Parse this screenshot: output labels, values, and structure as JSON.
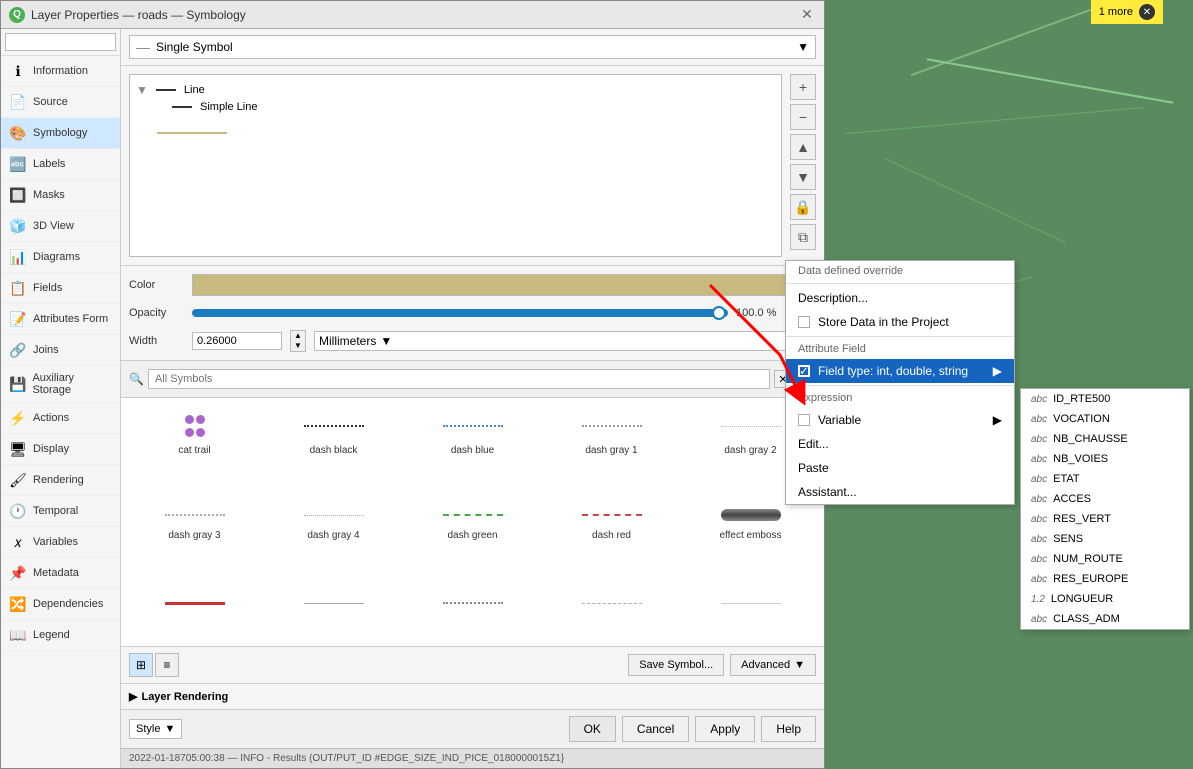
{
  "window": {
    "title": "Layer Properties — roads — Symbology",
    "close_label": "✕"
  },
  "sidebar": {
    "search_placeholder": "",
    "items": [
      {
        "id": "information",
        "label": "Information",
        "icon": "ℹ"
      },
      {
        "id": "source",
        "label": "Source",
        "icon": "📄"
      },
      {
        "id": "symbology",
        "label": "Symbology",
        "icon": "🎨",
        "active": true
      },
      {
        "id": "labels",
        "label": "Labels",
        "icon": "🔤"
      },
      {
        "id": "masks",
        "label": "Masks",
        "icon": "🔲"
      },
      {
        "id": "3d-view",
        "label": "3D View",
        "icon": "🧊"
      },
      {
        "id": "diagrams",
        "label": "Diagrams",
        "icon": "📊"
      },
      {
        "id": "fields",
        "label": "Fields",
        "icon": "📋"
      },
      {
        "id": "attributes-form",
        "label": "Attributes Form",
        "icon": "📝"
      },
      {
        "id": "joins",
        "label": "Joins",
        "icon": "🔗"
      },
      {
        "id": "auxiliary-storage",
        "label": "Auxiliary Storage",
        "icon": "💾"
      },
      {
        "id": "actions",
        "label": "Actions",
        "icon": "⚡"
      },
      {
        "id": "display",
        "label": "Display",
        "icon": "🖥"
      },
      {
        "id": "rendering",
        "label": "Rendering",
        "icon": "🖌"
      },
      {
        "id": "temporal",
        "label": "Temporal",
        "icon": "🕐"
      },
      {
        "id": "variables",
        "label": "Variables",
        "icon": "𝑥"
      },
      {
        "id": "metadata",
        "label": "Metadata",
        "icon": "📌"
      },
      {
        "id": "dependencies",
        "label": "Dependencies",
        "icon": "🔀"
      },
      {
        "id": "legend",
        "label": "Legend",
        "icon": "📖"
      }
    ]
  },
  "top_dropdown": {
    "label": "Single Symbol",
    "arrow": "▼"
  },
  "symbol_tree": {
    "line_label": "Line",
    "simple_line_label": "Simple Line"
  },
  "properties": {
    "color_label": "Color",
    "opacity_label": "Opacity",
    "opacity_value": "100.0 %",
    "width_label": "Width",
    "width_value": "0.26000",
    "unit_label": "Millimeters"
  },
  "search": {
    "placeholder": "All Symbols",
    "clear_label": "✕"
  },
  "symbols": [
    {
      "name": "cat trail",
      "pattern": "cat"
    },
    {
      "name": "dash  black",
      "pattern": "dotted-black"
    },
    {
      "name": "dash blue",
      "pattern": "dotted-blue"
    },
    {
      "name": "dash gray 1",
      "pattern": "dotted-gray"
    },
    {
      "name": "dash gray 2",
      "pattern": "dotted-gray2"
    },
    {
      "name": "dash gray 3",
      "pattern": "dotted-gray3"
    },
    {
      "name": "dash gray 4",
      "pattern": "dotted-gray4"
    },
    {
      "name": "dash green",
      "pattern": "dashed-green"
    },
    {
      "name": "dash red",
      "pattern": "dashed-red"
    },
    {
      "name": "effect emboss",
      "pattern": "emboss"
    }
  ],
  "bottom_toolbar": {
    "save_symbol_label": "Save Symbol...",
    "advanced_label": "Advanced",
    "advanced_arrow": "▼"
  },
  "layer_rendering": {
    "label": "Layer Rendering"
  },
  "footer": {
    "style_label": "Style",
    "style_arrow": "▼",
    "ok_label": "OK",
    "cancel_label": "Cancel",
    "apply_label": "Apply",
    "help_label": "Help"
  },
  "status_bar": {
    "text": "2022-01-18705:00:38 — INFO - Results (OUT/PUT_ID #EDGE_SIZE_IND_PICE_0180000015Z1}"
  },
  "context_menu": {
    "title": "Data defined override",
    "items": [
      {
        "id": "description",
        "label": "Description...",
        "type": "action"
      },
      {
        "id": "store-data",
        "label": "Store Data in the Project",
        "type": "checkbox",
        "checked": false
      },
      {
        "id": "attribute-field-header",
        "label": "Attribute Field",
        "type": "header"
      },
      {
        "id": "field-type",
        "label": "Field type: int, double, string",
        "type": "action",
        "highlighted": true,
        "has_arrow": true
      },
      {
        "id": "expression-header",
        "label": "Expression",
        "type": "header"
      },
      {
        "id": "variable",
        "label": "Variable",
        "type": "action",
        "has_arrow": true
      },
      {
        "id": "edit",
        "label": "Edit...",
        "type": "action"
      },
      {
        "id": "paste",
        "label": "Paste",
        "type": "action"
      },
      {
        "id": "assistant",
        "label": "Assistant...",
        "type": "action"
      }
    ]
  },
  "field_list": {
    "fields": [
      {
        "name": "ID_RTE500",
        "type": "abc"
      },
      {
        "name": "VOCATION",
        "type": "abc"
      },
      {
        "name": "NB_CHAUSSE",
        "type": "abc"
      },
      {
        "name": "NB_VOIES",
        "type": "abc"
      },
      {
        "name": "ETAT",
        "type": "abc"
      },
      {
        "name": "ACCES",
        "type": "abc"
      },
      {
        "name": "RES_VERT",
        "type": "abc"
      },
      {
        "name": "SENS",
        "type": "abc"
      },
      {
        "name": "NUM_ROUTE",
        "type": "abc"
      },
      {
        "name": "RES_EUROPE",
        "type": "abc"
      },
      {
        "name": "LONGUEUR",
        "type": "1.2"
      },
      {
        "name": "CLASS_ADM",
        "type": "abc"
      }
    ]
  },
  "map": {
    "notification": "1 more"
  }
}
